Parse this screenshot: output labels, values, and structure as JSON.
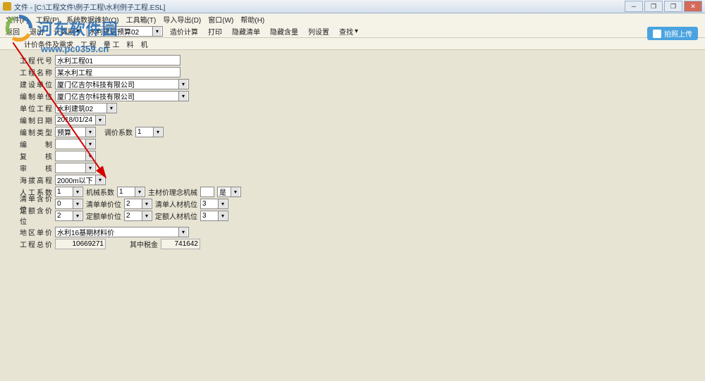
{
  "window": {
    "title": "文件 - [C:\\工程文件\\例子工程\\水利例子工程.ESL]"
  },
  "menu": {
    "file": "文件(F)",
    "proj": "工程(P)",
    "sysdata": "系统数据维护(Q)",
    "tools": "工具箱(T)",
    "impexp": "导入导出(D)",
    "window": "窗口(W)",
    "help": "帮助(H)"
  },
  "tb1": {
    "back": "返回",
    "exit": "退出",
    "calc": "计算器",
    "preset": "水利建筑预算02",
    "costcalc": "造价计算",
    "print": "打印",
    "hidelist": "隐藏清单",
    "hidecontent": "隐藏含量",
    "colset": "列设置",
    "find": "查找"
  },
  "tb2": {
    "a": "计价条件及需求",
    "b": "工   程",
    "c": "量   工",
    "d": "料",
    "e": "机"
  },
  "rightbtn": "拍照上传",
  "form": {
    "code_lbl": "工程代号",
    "code": "水利工程01",
    "name_lbl": "工程名称",
    "name": "某水利工程",
    "build_lbl": "建设单位",
    "build": "厦门亿吉尔科技有限公司",
    "compile_lbl": "编制单位",
    "compile": "厦门亿吉尔科技有限公司",
    "unit_lbl": "单位工程",
    "unit": "水利建筑02",
    "date_lbl": "编制日期",
    "date": "2018/01/24",
    "type_lbl": "编制类型",
    "type": "预算",
    "type2_lbl": "调价系数",
    "type2": "1",
    "bian_lbl": "编   制",
    "bian": "",
    "fu_lbl": "复   核",
    "fu": "",
    "shen_lbl": "审   核",
    "shen": "",
    "alt_lbl": "海拔高程",
    "alt": "2000m以下",
    "rg_lbl": "人工系数",
    "rg": "1",
    "jx_lbl": "机械系数",
    "jx": "1",
    "zc_lbl": "主材价理念机械",
    "zc": "是",
    "qdh_lbl": "清单含价位",
    "qdh": "0",
    "qdd_lbl": "清单单价位",
    "qdd": "2",
    "qdr_lbl": "清单人材机位",
    "qdr": "3",
    "deh_lbl": "定额含价位",
    "deh": "2",
    "ded_lbl": "定额单价位",
    "ded": "2",
    "der_lbl": "定额人材机位",
    "der": "3",
    "dq_lbl": "地区单价",
    "dq": "水利16基期材料价",
    "total_lbl": "工程总价",
    "total": "10669271",
    "tax_lbl": "其中税金",
    "tax": "741642"
  },
  "watermark": {
    "text": "河东软件园",
    "url": "www.pc0359.cn"
  }
}
